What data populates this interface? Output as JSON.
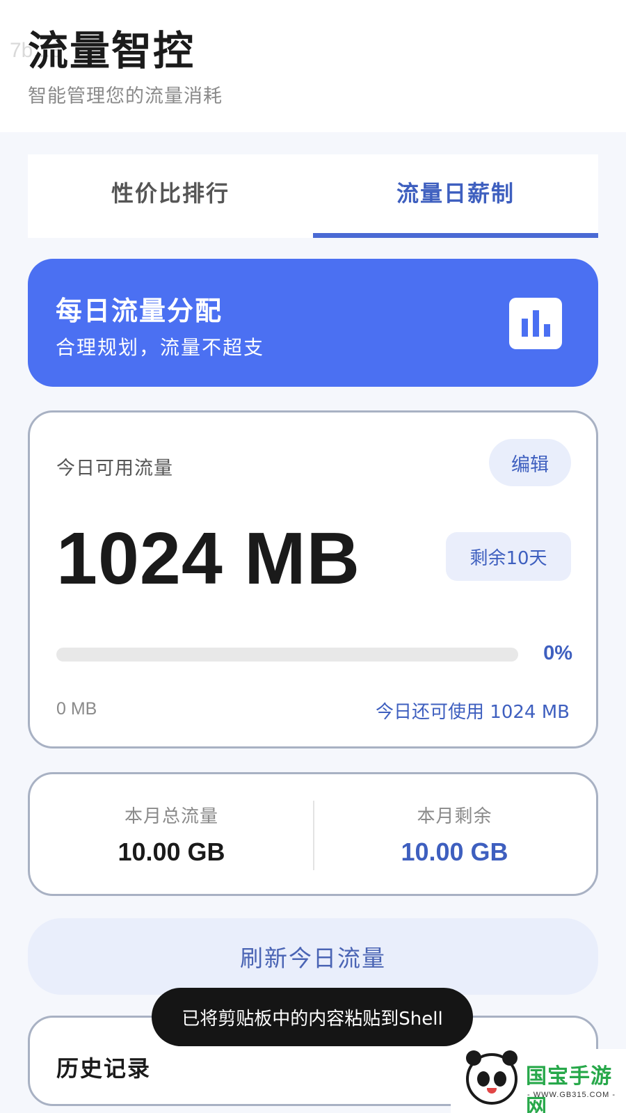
{
  "header": {
    "ghost_text": "7b...3",
    "title": "流量智控",
    "subtitle": "智能管理您的流量消耗"
  },
  "tabs": [
    {
      "label": "性价比排行",
      "active": false
    },
    {
      "label": "流量日薪制",
      "active": true
    }
  ],
  "banner": {
    "title": "每日流量分配",
    "subtitle": "合理规划，流量不超支",
    "icon": "bar-chart-icon",
    "color": "#4b70f2"
  },
  "today": {
    "label": "今日可用流量",
    "edit_label": "编辑",
    "amount": "1024 MB",
    "days_left": "剩余10天",
    "progress_fraction": 0,
    "progress_text": "0%",
    "used": "0 MB",
    "remaining_text": "今日还可使用 1024 MB"
  },
  "month": {
    "total_label": "本月总流量",
    "total_value": "10.00 GB",
    "remaining_label": "本月剩余",
    "remaining_value": "10.00 GB"
  },
  "refresh_label": "刷新今日流量",
  "history": {
    "title": "历史记录"
  },
  "toast": "已将剪贴板中的内容粘贴到Shell",
  "watermark": {
    "brand": "国宝手游网",
    "url": "- WWW.GB315.COM -",
    "icon": "panda-logo-icon"
  },
  "colors": {
    "accent": "#4b70f2",
    "accent_text": "#3e5fbf",
    "soft_accent": "#e9eefb"
  }
}
